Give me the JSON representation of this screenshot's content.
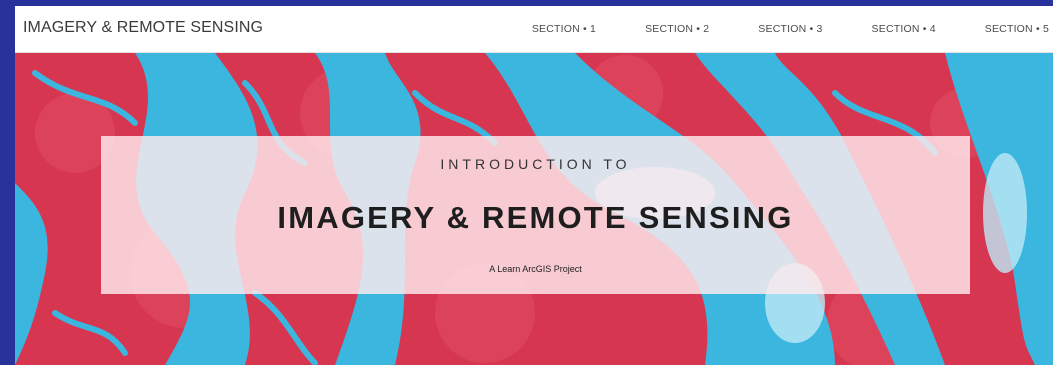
{
  "header": {
    "site_title": "IMAGERY & REMOTE SENSING",
    "nav": [
      {
        "label": "SECTION • 1"
      },
      {
        "label": "SECTION • 2"
      },
      {
        "label": "SECTION • 3"
      },
      {
        "label": "SECTION • 4"
      },
      {
        "label": "SECTION • 5"
      }
    ]
  },
  "hero": {
    "pre_title": "INTRODUCTION TO",
    "title": "IMAGERY & REMOTE SENSING",
    "subtitle": "A Learn ArcGIS Project"
  },
  "colors": {
    "page_background": "#27339a",
    "land": "#d83a52",
    "water": "#3bb6df"
  }
}
